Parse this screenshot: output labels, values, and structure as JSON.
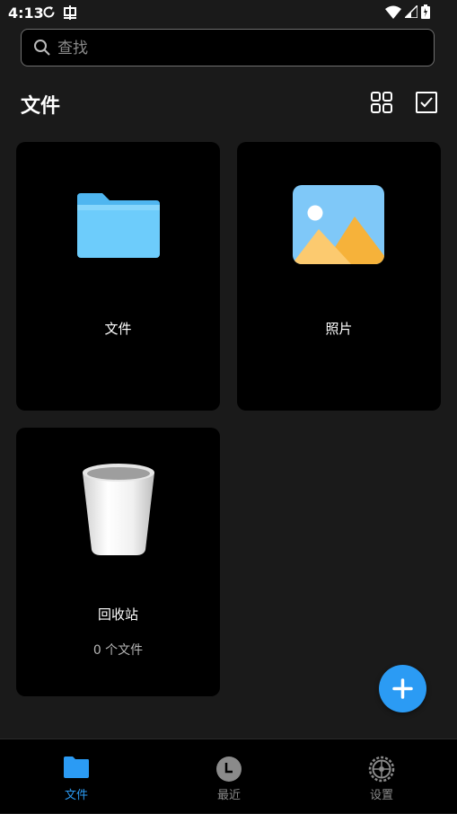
{
  "status_bar": {
    "time": "4:13"
  },
  "search": {
    "placeholder": "查找",
    "value": ""
  },
  "header": {
    "title": "文件",
    "grid_view_icon": "grid-view-icon",
    "select_icon": "checkbox-select-icon"
  },
  "cards": [
    {
      "label": "文件",
      "icon": "folder-icon"
    },
    {
      "label": "照片",
      "icon": "photo-icon"
    },
    {
      "label": "回收站",
      "sublabel": "0 个文件",
      "icon": "trash-bin-icon"
    }
  ],
  "fab": {
    "icon": "plus-icon"
  },
  "bottom_nav": {
    "items": [
      {
        "label": "文件",
        "icon": "folder-icon",
        "active": true
      },
      {
        "label": "最近",
        "icon": "clock-icon",
        "active": false
      },
      {
        "label": "设置",
        "icon": "gear-icon",
        "active": false
      }
    ]
  },
  "colors": {
    "background": "#1a1a1a",
    "card": "#000000",
    "accent": "#2b9bf4",
    "inactive_nav": "#8a8a8a"
  }
}
